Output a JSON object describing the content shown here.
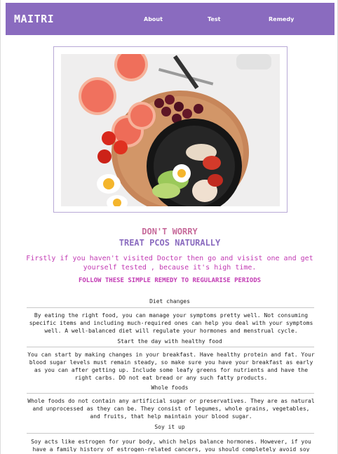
{
  "navbar": {
    "brand": "MAITRI",
    "links": [
      "About",
      "Test",
      "Remedy"
    ],
    "bg_color": "#8a6bbf"
  },
  "hero": {
    "image": "healthy-food-bowl"
  },
  "header": {
    "line1": "DON'T WORRY",
    "line2": "TREAT PCOS NATURALLY"
  },
  "intro": "Firstly if you haven't visited Doctor then go and visist one and get yourself tested , because it's high time.",
  "follow": "FOLLOW THESE SIMPLE REMEDY TO REGULARISE PERIODS",
  "sections": [
    {
      "title": "Diet changes",
      "text": "By eating the right food, you can manage your symptoms pretty well. Not consuming specific items and including much-required ones can help you deal with your symptoms well. A well-balanced diet will regulate your hormones and menstrual cycle."
    },
    {
      "title": "Start the day with healthy food",
      "text": "You can start by making changes in your breakfast. Have healthy protein and fat. Your blood sugar levels must remain steady, so make sure you have your breakfast as early as you can after getting up. Include some leafy greens for nutrients and have the right carbs. DO not eat bread or any such fatty products."
    },
    {
      "title": "Whole foods",
      "text": "Whole foods do not contain any artificial sugar or preservatives. They are as natural and unprocessed as they can be. They consist of legumes, whole grains, vegetables, and fruits, that help maintain your blood sugar."
    },
    {
      "title": "Soy it up",
      "text": "Soy acts like estrogen for your body, which helps balance hormones. However, if you have a family history of estrogen-related cancers, you should completely avoid soy products. It"
    }
  ]
}
